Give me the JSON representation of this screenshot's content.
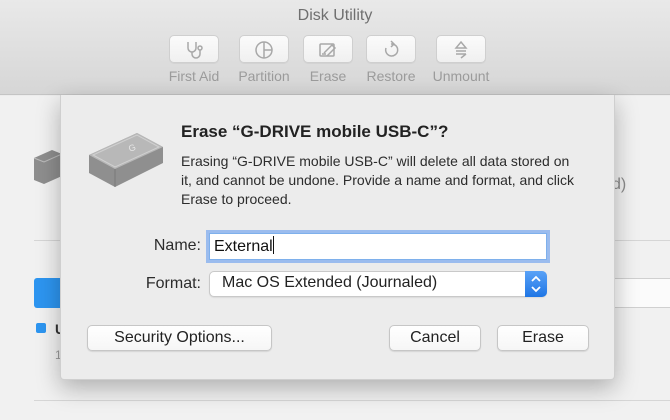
{
  "window": {
    "title": "Disk Utility"
  },
  "toolbar": {
    "items": [
      {
        "label": "First Aid",
        "icon": "stethoscope-icon"
      },
      {
        "label": "Partition",
        "icon": "pie-chart-icon"
      },
      {
        "label": "Erase",
        "icon": "erase-icon"
      },
      {
        "label": "Restore",
        "icon": "restore-icon"
      },
      {
        "label": "Unmount",
        "icon": "unmount-icon"
      }
    ]
  },
  "background": {
    "side_text": "d)",
    "label_partial": "U",
    "sub_partial": "1"
  },
  "dialog": {
    "title": "Erase “G-DRIVE mobile USB-C”?",
    "message": "Erasing “G-DRIVE mobile USB-C” will delete all data stored on it, and cannot be undone. Provide a name and format, and click Erase to proceed.",
    "name_label": "Name:",
    "name_value": "External",
    "format_label": "Format:",
    "format_value": "Mac OS Extended (Journaled)",
    "security_button": "Security Options...",
    "cancel_button": "Cancel",
    "erase_button": "Erase"
  },
  "colors": {
    "accent": "#2d95f0",
    "focus_ring": "#7eb0ec",
    "drive_silver": "#9a9a9a"
  }
}
